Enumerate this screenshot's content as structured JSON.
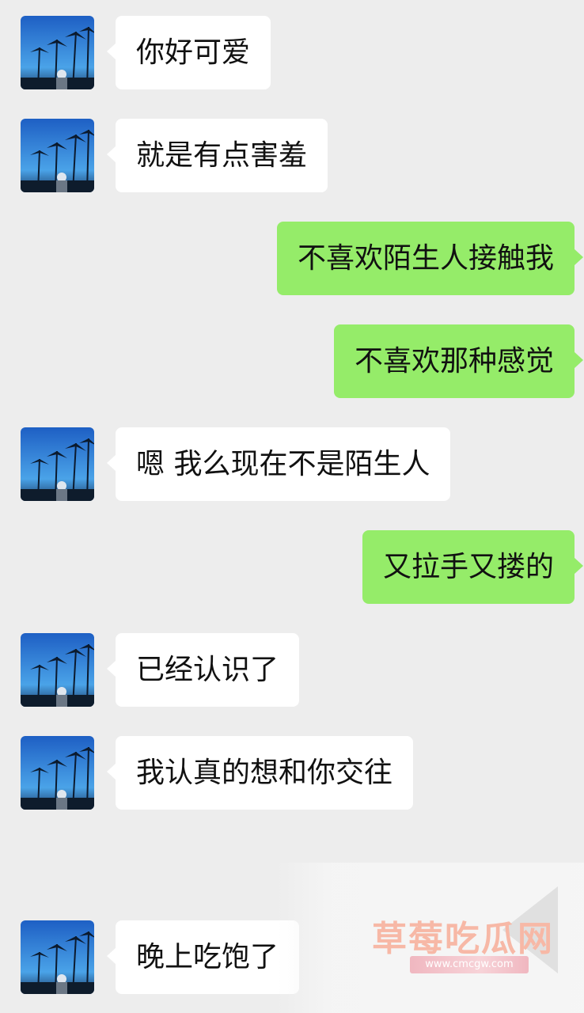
{
  "colors": {
    "background": "#ededed",
    "incoming_bubble": "#ffffff",
    "outgoing_bubble": "#95ec69",
    "text": "#111111"
  },
  "messages": [
    {
      "side": "left",
      "text": "你好可爱",
      "avatar": "palm-trees-avatar"
    },
    {
      "side": "left",
      "text": "就是有点害羞",
      "avatar": "palm-trees-avatar"
    },
    {
      "side": "right",
      "text": "不喜欢陌生人接触我"
    },
    {
      "side": "right",
      "text": "不喜欢那种感觉"
    },
    {
      "side": "left",
      "text": "嗯 我么现在不是陌生人",
      "avatar": "palm-trees-avatar"
    },
    {
      "side": "right",
      "text": "又拉手又搂的"
    },
    {
      "side": "left",
      "text": "已经认识了",
      "avatar": "palm-trees-avatar"
    },
    {
      "side": "left",
      "text": "我认真的想和你交往",
      "avatar": "palm-trees-avatar"
    },
    {
      "side": "left",
      "text": "晚上吃饱了",
      "avatar": "palm-trees-avatar"
    }
  ],
  "watermark": {
    "title": "草莓吃瓜网",
    "url": "www.cmcgw.com"
  }
}
